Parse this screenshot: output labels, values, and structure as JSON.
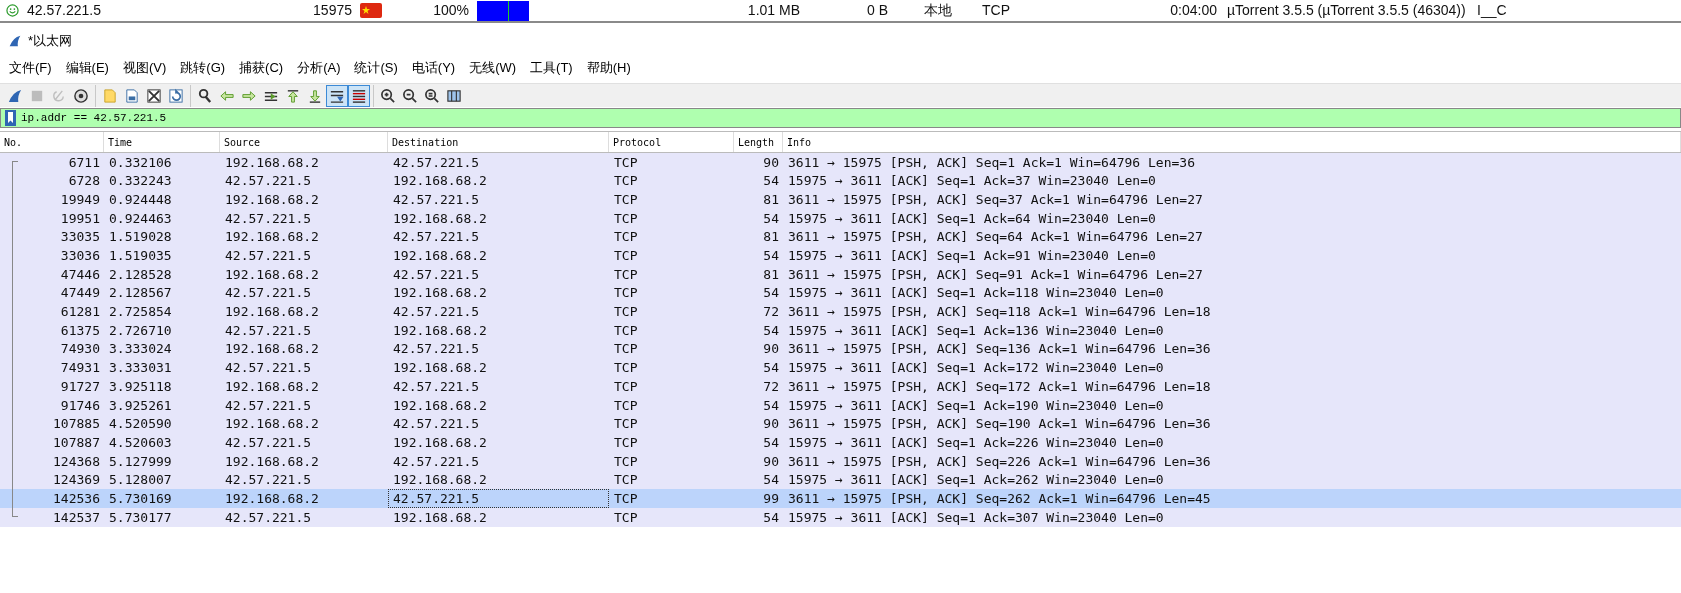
{
  "peer_row": {
    "ip": "42.57.221.5",
    "port": "15975",
    "progress": "100%",
    "pieces": {
      "level": 1
    },
    "downloaded": "1.01 MB",
    "uploaded": "0 B",
    "source": "本地",
    "transport": "TCP",
    "time": "0:04:00",
    "client": "µTorrent 3.5.5 (µTorrent 3.5.5 (46304))",
    "flags": "I__C"
  },
  "window": {
    "title": "*以太网"
  },
  "menu": [
    "文件(F)",
    "编辑(E)",
    "视图(V)",
    "跳转(G)",
    "捕获(C)",
    "分析(A)",
    "统计(S)",
    "电话(Y)",
    "无线(W)",
    "工具(T)",
    "帮助(H)"
  ],
  "toolbar": {
    "groups": [
      [
        {
          "kind": "fin",
          "on": false,
          "disabled": false
        },
        {
          "kind": "stop",
          "on": false,
          "disabled": true
        },
        {
          "kind": "restart",
          "on": false,
          "disabled": true
        },
        {
          "kind": "options",
          "on": false,
          "disabled": false
        }
      ],
      [
        {
          "kind": "open",
          "on": false,
          "disabled": false
        },
        {
          "kind": "save",
          "on": false,
          "disabled": false
        },
        {
          "kind": "close",
          "on": false,
          "disabled": false
        },
        {
          "kind": "reload",
          "on": false,
          "disabled": false
        }
      ],
      [
        {
          "kind": "find",
          "on": false,
          "disabled": false
        },
        {
          "kind": "back",
          "on": false,
          "disabled": false
        },
        {
          "kind": "forward",
          "on": false,
          "disabled": false
        },
        {
          "kind": "goto",
          "on": false,
          "disabled": false
        },
        {
          "kind": "first",
          "on": false,
          "disabled": false
        },
        {
          "kind": "last",
          "on": false,
          "disabled": false
        },
        {
          "kind": "autoscroll",
          "on": true,
          "disabled": false
        },
        {
          "kind": "colorize",
          "on": true,
          "disabled": false
        }
      ],
      [
        {
          "kind": "zoomin",
          "on": false,
          "disabled": false
        },
        {
          "kind": "zoomout",
          "on": false,
          "disabled": false
        },
        {
          "kind": "zoomreset",
          "on": false,
          "disabled": false
        },
        {
          "kind": "resize",
          "on": false,
          "disabled": false
        }
      ]
    ]
  },
  "filter": {
    "value": "ip.addr == 42.57.221.5",
    "valid": true
  },
  "table": {
    "columns": [
      {
        "label": "No.",
        "focused": false
      },
      {
        "label": "Time",
        "focused": false
      },
      {
        "label": "Source",
        "focused": false
      },
      {
        "label": "Destination",
        "focused": true
      },
      {
        "label": "Protocol",
        "focused": false
      },
      {
        "label": "Length",
        "focused": false
      },
      {
        "label": "Info",
        "focused": false
      }
    ],
    "rows": [
      {
        "cells": [
          "6711",
          "0.332106",
          "192.168.68.2",
          "42.57.221.5",
          "TCP",
          "90",
          "3611 → 15975 [PSH, ACK] Seq=1 Ack=1 Win=64796 Len=36"
        ],
        "selected": false,
        "focused": false
      },
      {
        "cells": [
          "6728",
          "0.332243",
          "42.57.221.5",
          "192.168.68.2",
          "TCP",
          "54",
          "15975 → 3611 [ACK] Seq=1 Ack=37 Win=23040 Len=0"
        ],
        "selected": false,
        "focused": false
      },
      {
        "cells": [
          "19949",
          "0.924448",
          "192.168.68.2",
          "42.57.221.5",
          "TCP",
          "81",
          "3611 → 15975 [PSH, ACK] Seq=37 Ack=1 Win=64796 Len=27"
        ],
        "selected": false,
        "focused": false
      },
      {
        "cells": [
          "19951",
          "0.924463",
          "42.57.221.5",
          "192.168.68.2",
          "TCP",
          "54",
          "15975 → 3611 [ACK] Seq=1 Ack=64 Win=23040 Len=0"
        ],
        "selected": false,
        "focused": false
      },
      {
        "cells": [
          "33035",
          "1.519028",
          "192.168.68.2",
          "42.57.221.5",
          "TCP",
          "81",
          "3611 → 15975 [PSH, ACK] Seq=64 Ack=1 Win=64796 Len=27"
        ],
        "selected": false,
        "focused": false
      },
      {
        "cells": [
          "33036",
          "1.519035",
          "42.57.221.5",
          "192.168.68.2",
          "TCP",
          "54",
          "15975 → 3611 [ACK] Seq=1 Ack=91 Win=23040 Len=0"
        ],
        "selected": false,
        "focused": false
      },
      {
        "cells": [
          "47446",
          "2.128528",
          "192.168.68.2",
          "42.57.221.5",
          "TCP",
          "81",
          "3611 → 15975 [PSH, ACK] Seq=91 Ack=1 Win=64796 Len=27"
        ],
        "selected": false,
        "focused": false
      },
      {
        "cells": [
          "47449",
          "2.128567",
          "42.57.221.5",
          "192.168.68.2",
          "TCP",
          "54",
          "15975 → 3611 [ACK] Seq=1 Ack=118 Win=23040 Len=0"
        ],
        "selected": false,
        "focused": false
      },
      {
        "cells": [
          "61281",
          "2.725854",
          "192.168.68.2",
          "42.57.221.5",
          "TCP",
          "72",
          "3611 → 15975 [PSH, ACK] Seq=118 Ack=1 Win=64796 Len=18"
        ],
        "selected": false,
        "focused": false
      },
      {
        "cells": [
          "61375",
          "2.726710",
          "42.57.221.5",
          "192.168.68.2",
          "TCP",
          "54",
          "15975 → 3611 [ACK] Seq=1 Ack=136 Win=23040 Len=0"
        ],
        "selected": false,
        "focused": false
      },
      {
        "cells": [
          "74930",
          "3.333024",
          "192.168.68.2",
          "42.57.221.5",
          "TCP",
          "90",
          "3611 → 15975 [PSH, ACK] Seq=136 Ack=1 Win=64796 Len=36"
        ],
        "selected": false,
        "focused": false
      },
      {
        "cells": [
          "74931",
          "3.333031",
          "42.57.221.5",
          "192.168.68.2",
          "TCP",
          "54",
          "15975 → 3611 [ACK] Seq=1 Ack=172 Win=23040 Len=0"
        ],
        "selected": false,
        "focused": false
      },
      {
        "cells": [
          "91727",
          "3.925118",
          "192.168.68.2",
          "42.57.221.5",
          "TCP",
          "72",
          "3611 → 15975 [PSH, ACK] Seq=172 Ack=1 Win=64796 Len=18"
        ],
        "selected": false,
        "focused": false
      },
      {
        "cells": [
          "91746",
          "3.925261",
          "42.57.221.5",
          "192.168.68.2",
          "TCP",
          "54",
          "15975 → 3611 [ACK] Seq=1 Ack=190 Win=23040 Len=0"
        ],
        "selected": false,
        "focused": false
      },
      {
        "cells": [
          "107885",
          "4.520590",
          "192.168.68.2",
          "42.57.221.5",
          "TCP",
          "90",
          "3611 → 15975 [PSH, ACK] Seq=190 Ack=1 Win=64796 Len=36"
        ],
        "selected": false,
        "focused": false
      },
      {
        "cells": [
          "107887",
          "4.520603",
          "42.57.221.5",
          "192.168.68.2",
          "TCP",
          "54",
          "15975 → 3611 [ACK] Seq=1 Ack=226 Win=23040 Len=0"
        ],
        "selected": false,
        "focused": false
      },
      {
        "cells": [
          "124368",
          "5.127999",
          "192.168.68.2",
          "42.57.221.5",
          "TCP",
          "90",
          "3611 → 15975 [PSH, ACK] Seq=226 Ack=1 Win=64796 Len=36"
        ],
        "selected": false,
        "focused": false
      },
      {
        "cells": [
          "124369",
          "5.128007",
          "42.57.221.5",
          "192.168.68.2",
          "TCP",
          "54",
          "15975 → 3611 [ACK] Seq=1 Ack=262 Win=23040 Len=0"
        ],
        "selected": false,
        "focused": false
      },
      {
        "cells": [
          "142536",
          "5.730169",
          "192.168.68.2",
          "42.57.221.5",
          "TCP",
          "99",
          "3611 → 15975 [PSH, ACK] Seq=262 Ack=1 Win=64796 Len=45"
        ],
        "selected": true,
        "focused": true
      },
      {
        "cells": [
          "142537",
          "5.730177",
          "42.57.221.5",
          "192.168.68.2",
          "TCP",
          "54",
          "15975 → 3611 [ACK] Seq=1 Ack=307 Win=23040 Len=0"
        ],
        "selected": false,
        "focused": false
      }
    ]
  }
}
